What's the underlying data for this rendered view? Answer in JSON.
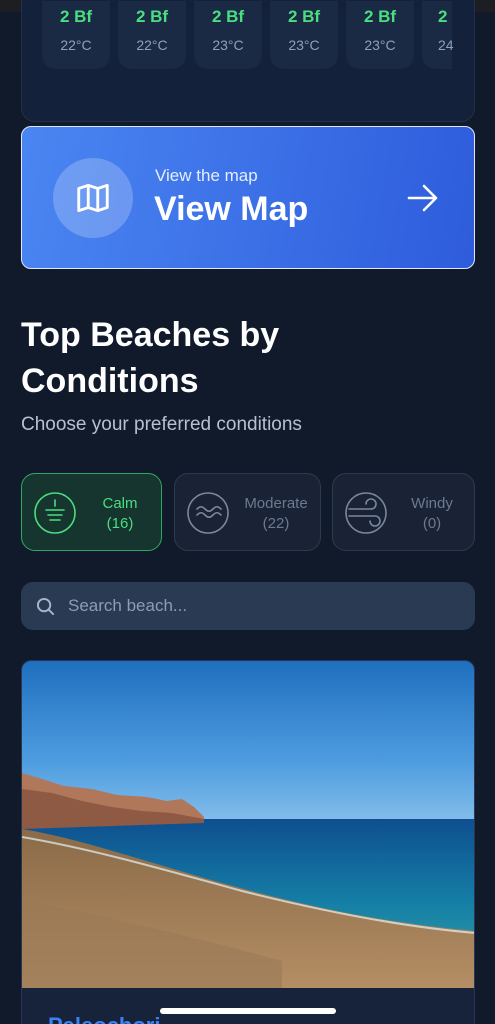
{
  "forecast": {
    "items": [
      {
        "bf": "2 Bf",
        "temp": "22°C"
      },
      {
        "bf": "2 Bf",
        "temp": "22°C"
      },
      {
        "bf": "2 Bf",
        "temp": "23°C"
      },
      {
        "bf": "2 Bf",
        "temp": "23°C"
      },
      {
        "bf": "2 Bf",
        "temp": "23°C"
      },
      {
        "bf": "2",
        "temp": "24"
      }
    ]
  },
  "map_banner": {
    "subtitle": "View the map",
    "title": "View Map",
    "icon": "map-icon",
    "arrow_icon": "arrow-right-icon"
  },
  "section": {
    "title": "Top Beaches by Conditions",
    "subtitle": "Choose your preferred conditions"
  },
  "filters": [
    {
      "label": "Calm",
      "count": "(16)",
      "icon": "calm-water-icon",
      "active": true
    },
    {
      "label": "Moderate",
      "count": "(22)",
      "icon": "waves-icon",
      "active": false
    },
    {
      "label": "Windy",
      "count": "(0)",
      "icon": "wind-icon",
      "active": false
    }
  ],
  "search": {
    "placeholder": "Search beach..."
  },
  "beach_card": {
    "name": "Paleochori"
  },
  "colors": {
    "background": "#111a2b",
    "accent_green": "#4ade80",
    "accent_blue": "#3b82f6"
  }
}
